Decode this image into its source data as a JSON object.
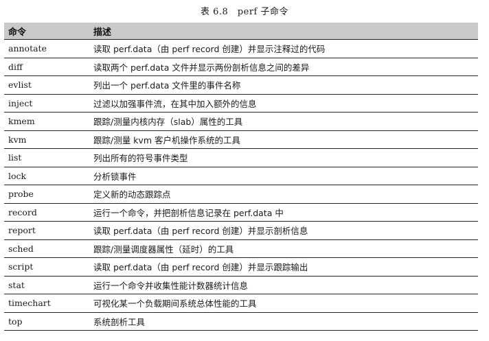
{
  "caption": "表 6.8　perf 子命令",
  "table": {
    "headers": [
      "命令",
      "描述"
    ],
    "rows": [
      {
        "cmd": "annotate",
        "desc": "读取 perf.data（由 perf record 创建）并显示注释过的代码"
      },
      {
        "cmd": "diff",
        "desc": "读取两个 perf.data 文件并显示两份剖析信息之间的差异"
      },
      {
        "cmd": "evlist",
        "desc": "列出一个 perf.data 文件里的事件名称"
      },
      {
        "cmd": "inject",
        "desc": "过滤以加强事件流，在其中加入额外的信息"
      },
      {
        "cmd": "kmem",
        "desc": "跟踪/测量内核内存（slab）属性的工具"
      },
      {
        "cmd": "kvm",
        "desc": "跟踪/测量 kvm 客户机操作系统的工具"
      },
      {
        "cmd": "list",
        "desc": "列出所有的符号事件类型"
      },
      {
        "cmd": "lock",
        "desc": "分析锁事件"
      },
      {
        "cmd": "probe",
        "desc": "定义新的动态跟踪点"
      },
      {
        "cmd": "record",
        "desc": "运行一个命令，并把剖析信息记录在 perf.data 中"
      },
      {
        "cmd": "report",
        "desc": "读取 perf.data（由 perf record 创建）并显示剖析信息"
      },
      {
        "cmd": "sched",
        "desc": "跟踪/测量调度器属性（延时）的工具"
      },
      {
        "cmd": "script",
        "desc": "读取 perf.data（由 perf record 创建）并显示跟踪输出"
      },
      {
        "cmd": "stat",
        "desc": "运行一个命令并收集性能计数器统计信息"
      },
      {
        "cmd": "timechart",
        "desc": "可视化某一个负载期间系统总体性能的工具"
      },
      {
        "cmd": "top",
        "desc": "系统剖析工具"
      }
    ]
  }
}
